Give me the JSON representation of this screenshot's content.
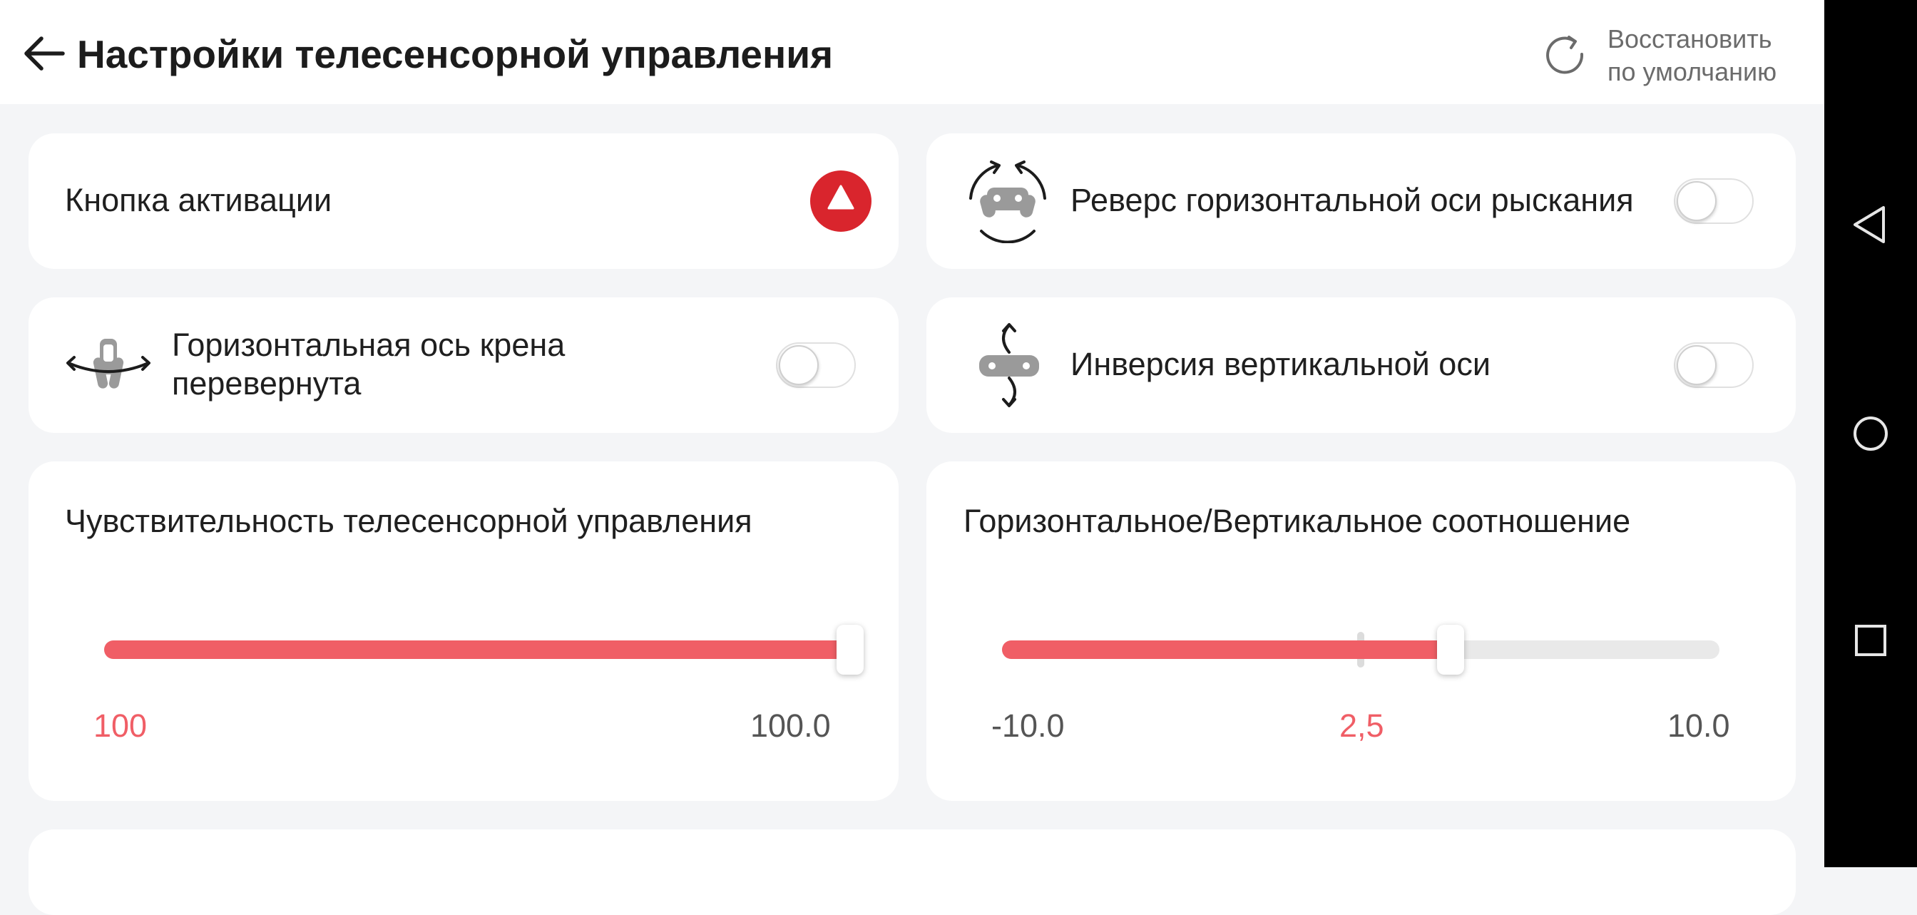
{
  "header": {
    "title": "Настройки телесенсорной управления",
    "reset_line1": "Восстановить",
    "reset_line2": "по умолчанию"
  },
  "settings": {
    "activation": {
      "label": "Кнопка активации",
      "icon": "triangle-up-icon"
    },
    "yaw_reverse": {
      "label": "Реверс горизонтальной оси рыскания",
      "enabled": false,
      "icon": "gamepad-yaw-rotate-icon"
    },
    "roll_flip": {
      "label": "Горизонтальная ось крена перевернута",
      "enabled": false,
      "icon": "gamepad-roll-rotate-icon"
    },
    "vertical_invert": {
      "label": "Инверсия вертикальной оси",
      "enabled": false,
      "icon": "gamepad-pitch-rotate-icon"
    }
  },
  "sensitivity": {
    "title": "Чувствительность телесенсорной управления",
    "current": "100",
    "max_label": "100.0",
    "value": 100,
    "min": 0,
    "max": 100
  },
  "ratio": {
    "title": "Горизонтальное/Вертикальное соотношение",
    "min_label": "-10.0",
    "current": "2,5",
    "max_label": "10.0",
    "value": 2.5,
    "min": -10,
    "max": 10
  },
  "colors": {
    "accent": "#f05e66",
    "activation_button": "#d9252d",
    "track": "#e9e9e9"
  },
  "navbar": {
    "back": "nav-back-icon",
    "home": "nav-home-icon",
    "recents": "nav-recents-icon"
  }
}
